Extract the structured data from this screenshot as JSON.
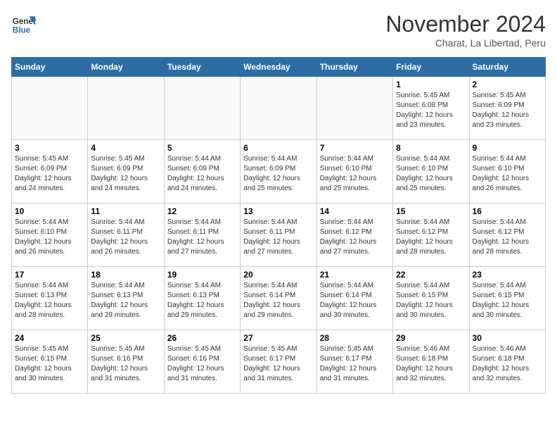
{
  "logo": {
    "line1": "General",
    "line2": "Blue"
  },
  "title": "November 2024",
  "subtitle": "Charat, La Libertad, Peru",
  "days_of_week": [
    "Sunday",
    "Monday",
    "Tuesday",
    "Wednesday",
    "Thursday",
    "Friday",
    "Saturday"
  ],
  "weeks": [
    [
      {
        "day": "",
        "detail": ""
      },
      {
        "day": "",
        "detail": ""
      },
      {
        "day": "",
        "detail": ""
      },
      {
        "day": "",
        "detail": ""
      },
      {
        "day": "",
        "detail": ""
      },
      {
        "day": "1",
        "detail": "Sunrise: 5:45 AM\nSunset: 6:08 PM\nDaylight: 12 hours and 23 minutes."
      },
      {
        "day": "2",
        "detail": "Sunrise: 5:45 AM\nSunset: 6:09 PM\nDaylight: 12 hours and 23 minutes."
      }
    ],
    [
      {
        "day": "3",
        "detail": "Sunrise: 5:45 AM\nSunset: 6:09 PM\nDaylight: 12 hours and 24 minutes."
      },
      {
        "day": "4",
        "detail": "Sunrise: 5:45 AM\nSunset: 6:09 PM\nDaylight: 12 hours and 24 minutes."
      },
      {
        "day": "5",
        "detail": "Sunrise: 5:44 AM\nSunset: 6:09 PM\nDaylight: 12 hours and 24 minutes."
      },
      {
        "day": "6",
        "detail": "Sunrise: 5:44 AM\nSunset: 6:09 PM\nDaylight: 12 hours and 25 minutes."
      },
      {
        "day": "7",
        "detail": "Sunrise: 5:44 AM\nSunset: 6:10 PM\nDaylight: 12 hours and 25 minutes."
      },
      {
        "day": "8",
        "detail": "Sunrise: 5:44 AM\nSunset: 6:10 PM\nDaylight: 12 hours and 25 minutes."
      },
      {
        "day": "9",
        "detail": "Sunrise: 5:44 AM\nSunset: 6:10 PM\nDaylight: 12 hours and 26 minutes."
      }
    ],
    [
      {
        "day": "10",
        "detail": "Sunrise: 5:44 AM\nSunset: 6:10 PM\nDaylight: 12 hours and 26 minutes."
      },
      {
        "day": "11",
        "detail": "Sunrise: 5:44 AM\nSunset: 6:11 PM\nDaylight: 12 hours and 26 minutes."
      },
      {
        "day": "12",
        "detail": "Sunrise: 5:44 AM\nSunset: 6:11 PM\nDaylight: 12 hours and 27 minutes."
      },
      {
        "day": "13",
        "detail": "Sunrise: 5:44 AM\nSunset: 6:11 PM\nDaylight: 12 hours and 27 minutes."
      },
      {
        "day": "14",
        "detail": "Sunrise: 5:44 AM\nSunset: 6:12 PM\nDaylight: 12 hours and 27 minutes."
      },
      {
        "day": "15",
        "detail": "Sunrise: 5:44 AM\nSunset: 6:12 PM\nDaylight: 12 hours and 28 minutes."
      },
      {
        "day": "16",
        "detail": "Sunrise: 5:44 AM\nSunset: 6:12 PM\nDaylight: 12 hours and 28 minutes."
      }
    ],
    [
      {
        "day": "17",
        "detail": "Sunrise: 5:44 AM\nSunset: 6:13 PM\nDaylight: 12 hours and 28 minutes."
      },
      {
        "day": "18",
        "detail": "Sunrise: 5:44 AM\nSunset: 6:13 PM\nDaylight: 12 hours and 29 minutes."
      },
      {
        "day": "19",
        "detail": "Sunrise: 5:44 AM\nSunset: 6:13 PM\nDaylight: 12 hours and 29 minutes."
      },
      {
        "day": "20",
        "detail": "Sunrise: 5:44 AM\nSunset: 6:14 PM\nDaylight: 12 hours and 29 minutes."
      },
      {
        "day": "21",
        "detail": "Sunrise: 5:44 AM\nSunset: 6:14 PM\nDaylight: 12 hours and 30 minutes."
      },
      {
        "day": "22",
        "detail": "Sunrise: 5:44 AM\nSunset: 6:15 PM\nDaylight: 12 hours and 30 minutes."
      },
      {
        "day": "23",
        "detail": "Sunrise: 5:44 AM\nSunset: 6:15 PM\nDaylight: 12 hours and 30 minutes."
      }
    ],
    [
      {
        "day": "24",
        "detail": "Sunrise: 5:45 AM\nSunset: 6:15 PM\nDaylight: 12 hours and 30 minutes."
      },
      {
        "day": "25",
        "detail": "Sunrise: 5:45 AM\nSunset: 6:16 PM\nDaylight: 12 hours and 31 minutes."
      },
      {
        "day": "26",
        "detail": "Sunrise: 5:45 AM\nSunset: 6:16 PM\nDaylight: 12 hours and 31 minutes."
      },
      {
        "day": "27",
        "detail": "Sunrise: 5:45 AM\nSunset: 6:17 PM\nDaylight: 12 hours and 31 minutes."
      },
      {
        "day": "28",
        "detail": "Sunrise: 5:45 AM\nSunset: 6:17 PM\nDaylight: 12 hours and 31 minutes."
      },
      {
        "day": "29",
        "detail": "Sunrise: 5:46 AM\nSunset: 6:18 PM\nDaylight: 12 hours and 32 minutes."
      },
      {
        "day": "30",
        "detail": "Sunrise: 5:46 AM\nSunset: 6:18 PM\nDaylight: 12 hours and 32 minutes."
      }
    ]
  ]
}
